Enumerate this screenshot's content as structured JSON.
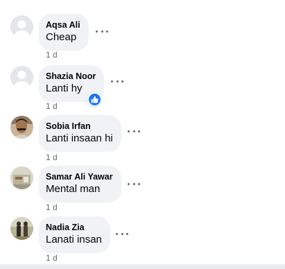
{
  "comments": [
    {
      "author": "Aqsa Ali",
      "text": "Cheap",
      "time": "1 d",
      "avatar": "default-avatar"
    },
    {
      "author": "Shazia Noor",
      "text": "Lanti hy",
      "time": "1 d",
      "avatar": "default-avatar",
      "reaction": "like-icon"
    },
    {
      "author": "Sobia Irfan",
      "text": "Lanti insaan hi",
      "time": "1 d",
      "avatar": "photo-avatar"
    },
    {
      "author": "Samar Ali Yawar",
      "text": "Mental man",
      "time": "1 d",
      "avatar": "photo-avatar"
    },
    {
      "author": "Nadia Zia",
      "text": "Lanati insan",
      "time": "1 d",
      "avatar": "photo-avatar"
    }
  ],
  "colors": {
    "bubble": "#f0f2f5",
    "text": "#050505",
    "secondary": "#65676b",
    "like": "#1877f2"
  }
}
